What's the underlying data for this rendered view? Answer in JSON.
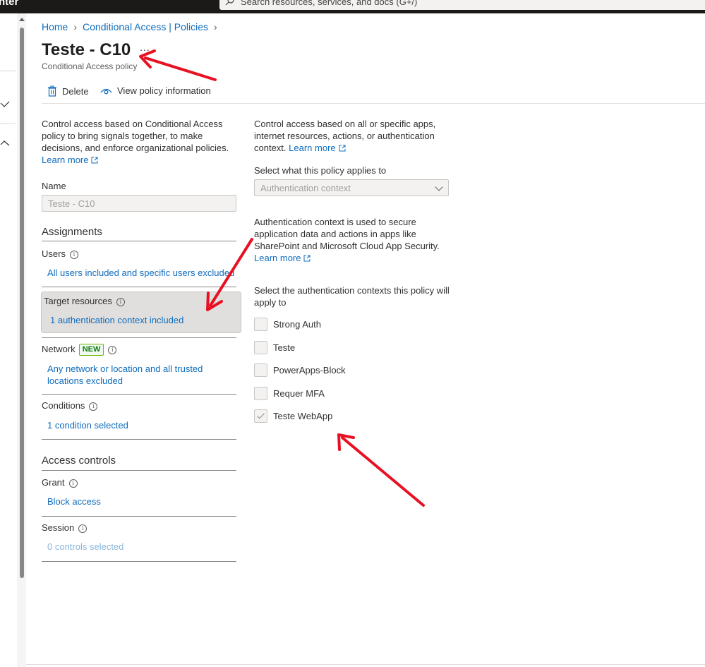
{
  "topbar": {
    "brand": "nter",
    "search_placeholder": "Search resources, services, and docs (G+/)"
  },
  "breadcrumb": {
    "home": "Home",
    "policies": "Conditional Access | Policies"
  },
  "header": {
    "title": "Teste - C10",
    "more": "...",
    "subtitle": "Conditional Access policy"
  },
  "toolbar": {
    "delete_label": "Delete",
    "view_info_label": "View policy information"
  },
  "left": {
    "intro": "Control access based on Conditional Access policy to bring signals together, to make decisions, and enforce organizational policies.",
    "learn_more": "Learn more",
    "name_label": "Name",
    "name_value": "Teste - C10",
    "assignments_heading": "Assignments",
    "users_label": "Users",
    "users_value": "All users included and specific users excluded",
    "target_label": "Target resources",
    "target_value": "1 authentication context included",
    "network_label": "Network",
    "network_badge": "NEW",
    "network_value": "Any network or location and all trusted locations excluded",
    "conditions_label": "Conditions",
    "conditions_value": "1 condition selected",
    "access_heading": "Access controls",
    "grant_label": "Grant",
    "grant_value": "Block access",
    "session_label": "Session",
    "session_value": "0 controls selected"
  },
  "right": {
    "intro": "Control access based on all or specific apps, internet resources, actions, or authentication context.",
    "learn_more": "Learn more",
    "applies_label": "Select what this policy applies to",
    "applies_value": "Authentication context",
    "auth_desc": "Authentication context is used to secure application data and actions in apps like SharePoint and Microsoft Cloud App Security.",
    "learn_more2": "Learn more",
    "select_label": "Select the authentication contexts this policy will apply to",
    "contexts": [
      {
        "label": "Strong Auth",
        "checked": false
      },
      {
        "label": "Teste",
        "checked": false
      },
      {
        "label": "PowerApps-Block",
        "checked": false
      },
      {
        "label": "Requer MFA",
        "checked": false
      },
      {
        "label": "Teste WebApp",
        "checked": true
      }
    ]
  },
  "colors": {
    "link": "#0f6cbd",
    "annotation_arrow": "#e81123",
    "badge_green": "#107c10"
  }
}
